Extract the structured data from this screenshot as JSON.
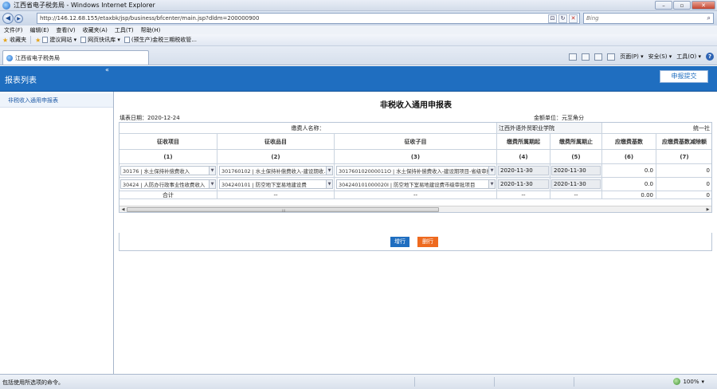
{
  "window": {
    "title": "江西省电子税务局 - Windows Internet Explorer",
    "url": "http://146.12.68.155/etaxbk/jsp/business/bfcenter/main.jsp?dldm=200000900",
    "search_placeholder": "Bing",
    "menu": [
      "文件(F)",
      "编辑(E)",
      "查看(V)",
      "收藏夹(A)",
      "工具(T)",
      "帮助(H)"
    ],
    "favorites_label": "收藏夹",
    "favorites": [
      "建议网站 ▾",
      "网页快讯库 ▾",
      "(预生产)金税三期税收管..."
    ],
    "tab_title": "江西省电子税务局",
    "commands": [
      "页面(P) ▾",
      "安全(S) ▾",
      "工具(O) ▾"
    ],
    "status_text": "包括使用所选项的命令。",
    "zoom": "100%"
  },
  "app": {
    "sidebar_title": "报表列表",
    "collapse_glyph": "«",
    "submit_label": "申报提交",
    "sidebar_items": [
      "非税收入通用申报表"
    ],
    "form": {
      "title": "非税收入通用申报表",
      "fill_date": "填表日期：2020-12-24",
      "unit": "金额单位：元至角分",
      "payer_label": "缴费人名称：",
      "payer_value": "江西外语外贸职业学院",
      "credit_code_label": "统一社",
      "headers": [
        "征收项目",
        "征收品目",
        "征收子目",
        "缴费所属期起",
        "缴费所属期止",
        "应缴费基数",
        "应缴费基数减除额"
      ],
      "header_nums": [
        "(1)",
        "(2)",
        "(3)",
        "(4)",
        "(5)",
        "(6)",
        "(7)"
      ],
      "rows": [
        {
          "item": "30176 | 水土保持补偿费收入",
          "category": "301760102 | 水土保持补偿费收入-建设期收...",
          "subitem": "301760102000011O | 水土保持补偿费收入-建设期项目-省级审批",
          "start": "2020-11-30",
          "end": "2020-11-30",
          "base": "0.0",
          "deduct": "0"
        },
        {
          "item": "30424 | 人防办行政事业性收费收入",
          "category": "304240101 | 防空地下室易地建设费",
          "subitem": "304240101000020I | 防空地下室易地建设费市级审批项目",
          "start": "2020-11-30",
          "end": "2020-11-30",
          "base": "0.0",
          "deduct": "0"
        }
      ],
      "total_label": "合计",
      "total_dash": "--",
      "total_base": "0.00",
      "total_deduct": "0",
      "add_row_label": "增行",
      "delete_row_label": "删行"
    }
  }
}
